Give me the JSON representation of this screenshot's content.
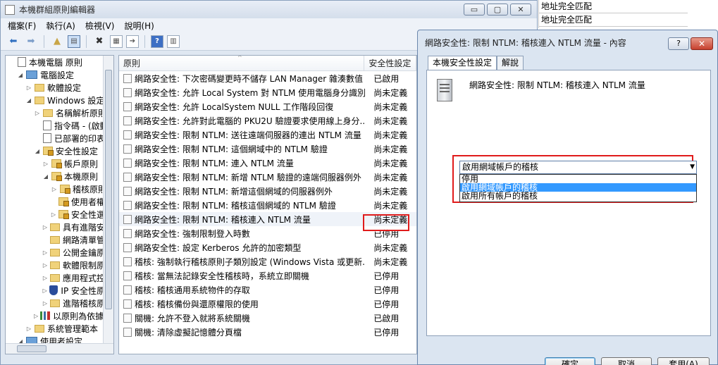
{
  "main_window": {
    "title": "本機群組原則編輯器",
    "buttons": {
      "minimize": "▭",
      "restore": "▢",
      "close": "✕"
    }
  },
  "menu": [
    "檔案(F)",
    "執行(A)",
    "檢視(V)",
    "說明(H)"
  ],
  "toolbar": {
    "back_icon": "back-arrow-icon",
    "forward_icon": "forward-arrow-icon",
    "up_icon": "up-folder-icon",
    "show_hide_tree_icon": "tree-pane-icon",
    "delete_icon": "delete-icon",
    "properties_icon": "properties-icon",
    "export_icon": "export-icon",
    "help_icon": "help-icon",
    "view_icon": "view-icon",
    "delete_glyph": "✖",
    "help_glyph": "?"
  },
  "tree": {
    "items": [
      {
        "label": "本機電腦 原則",
        "level": 0,
        "expander": "",
        "icon": "doc"
      },
      {
        "label": "電腦設定",
        "level": 1,
        "expander": "◢",
        "icon": "comp"
      },
      {
        "label": "軟體設定",
        "level": 2,
        "expander": "▷",
        "icon": "folder"
      },
      {
        "label": "Windows 設定",
        "level": 2,
        "expander": "◢",
        "icon": "folder"
      },
      {
        "label": "名稱解析原則",
        "level": 3,
        "expander": "▷",
        "icon": "folder"
      },
      {
        "label": "指令碼 - (啟動",
        "level": 3,
        "expander": "",
        "icon": "doc"
      },
      {
        "label": "已部署的印表機",
        "level": 3,
        "expander": "",
        "icon": "doc"
      },
      {
        "label": "安全性設定",
        "level": 3,
        "expander": "◢",
        "icon": "lockfolder"
      },
      {
        "label": "帳戶原則",
        "level": 4,
        "expander": "▷",
        "icon": "lockfolder"
      },
      {
        "label": "本機原則",
        "level": 4,
        "expander": "◢",
        "icon": "lockfolder"
      },
      {
        "label": "稽核原則",
        "level": 5,
        "expander": "▷",
        "icon": "lockfolder"
      },
      {
        "label": "使用者權限",
        "level": 5,
        "expander": "",
        "icon": "lockfolder"
      },
      {
        "label": "安全性選項",
        "level": 5,
        "expander": "▷",
        "icon": "lockfolder"
      },
      {
        "label": "具有進階安全",
        "level": 4,
        "expander": "▷",
        "icon": "folder"
      },
      {
        "label": "網路清單管理",
        "level": 4,
        "expander": "",
        "icon": "folder"
      },
      {
        "label": "公開金鑰原則",
        "level": 4,
        "expander": "▷",
        "icon": "folder"
      },
      {
        "label": "軟體限制原則",
        "level": 4,
        "expander": "▷",
        "icon": "folder"
      },
      {
        "label": "應用程式控制",
        "level": 4,
        "expander": "▷",
        "icon": "folder"
      },
      {
        "label": "IP 安全性原則",
        "level": 4,
        "expander": "▷",
        "icon": "shield"
      },
      {
        "label": "進階稽核原則",
        "level": 4,
        "expander": "▷",
        "icon": "folder"
      },
      {
        "label": "以原則為依據的 QoS",
        "level": 3,
        "expander": "▷",
        "icon": "chart"
      },
      {
        "label": "系統管理範本",
        "level": 2,
        "expander": "▷",
        "icon": "folder"
      },
      {
        "label": "使用者設定",
        "level": 1,
        "expander": "◢",
        "icon": "comp"
      }
    ]
  },
  "list": {
    "columns": {
      "policy": "原則",
      "setting": "安全性設定",
      "sort_arrow": "^"
    },
    "rows": [
      {
        "policy": "網路安全性: 下次密碼變更時不儲存 LAN Manager 雜湊數值",
        "setting": "已啟用"
      },
      {
        "policy": "網路安全性: 允許 Local System 對 NTLM 使用電腦身分識別",
        "setting": "尚未定義"
      },
      {
        "policy": "網路安全性: 允許 LocalSystem NULL 工作階段回復",
        "setting": "尚未定義"
      },
      {
        "policy": "網路安全性: 允許對此電腦的 PKU2U 驗證要求使用線上身分...",
        "setting": "尚未定義"
      },
      {
        "policy": "網路安全性: 限制 NTLM: 送往遠端伺服器的連出 NTLM 流量",
        "setting": "尚未定義"
      },
      {
        "policy": "網路安全性: 限制 NTLM: 這個網域中的 NTLM 驗證",
        "setting": "尚未定義"
      },
      {
        "policy": "網路安全性: 限制 NTLM: 連入 NTLM 流量",
        "setting": "尚未定義"
      },
      {
        "policy": "網路安全性: 限制 NTLM: 新增 NTLM 驗證的遠端伺服器例外",
        "setting": "尚未定義"
      },
      {
        "policy": "網路安全性: 限制 NTLM: 新增這個網域的伺服器例外",
        "setting": "尚未定義"
      },
      {
        "policy": "網路安全性: 限制 NTLM: 稽核這個網域的 NTLM 驗證",
        "setting": "尚未定義"
      },
      {
        "policy": "網路安全性: 限制 NTLM: 稽核連入 NTLM 流量",
        "setting": "尚未定義"
      },
      {
        "policy": "網路安全性: 強制限制登入時數",
        "setting": "已停用"
      },
      {
        "policy": "網路安全性: 設定 Kerberos 允許的加密類型",
        "setting": "尚未定義"
      },
      {
        "policy": "稽核: 強制執行稽核原則子類別設定 (Windows Vista 或更新...",
        "setting": "尚未定義"
      },
      {
        "policy": "稽核: 當無法記錄安全性稽核時，系統立即關機",
        "setting": "已停用"
      },
      {
        "policy": "稽核: 稽核通用系統物件的存取",
        "setting": "已停用"
      },
      {
        "policy": "稽核: 稽核備份與還原權限的使用",
        "setting": "已停用"
      },
      {
        "policy": "關機: 允許不登入就將系統關機",
        "setting": "已啟用"
      },
      {
        "policy": "關機: 清除虛擬記憶體分頁檔",
        "setting": "已停用"
      }
    ]
  },
  "background_cells": [
    "地址完全匹配",
    "地址完全匹配"
  ],
  "dialog": {
    "title": "網路安全性: 限制 NTLM: 稽核連入 NTLM 流量 - 內容",
    "help_btn": "?",
    "close_btn": "✕",
    "tabs": [
      "本機安全性設定",
      "解說"
    ],
    "policy_name": "網路安全性: 限制 NTLM: 稽核連入 NTLM 流量",
    "combo_value": "啟用網域帳戶的稽核",
    "combo_arrow": "▼",
    "options": [
      "停用",
      "啟用網域帳戶的稽核",
      "啟用所有帳戶的稽核"
    ],
    "selected_option_index": 1,
    "buttons": {
      "ok": "確定",
      "cancel": "取消",
      "apply": "套用(A)"
    }
  }
}
